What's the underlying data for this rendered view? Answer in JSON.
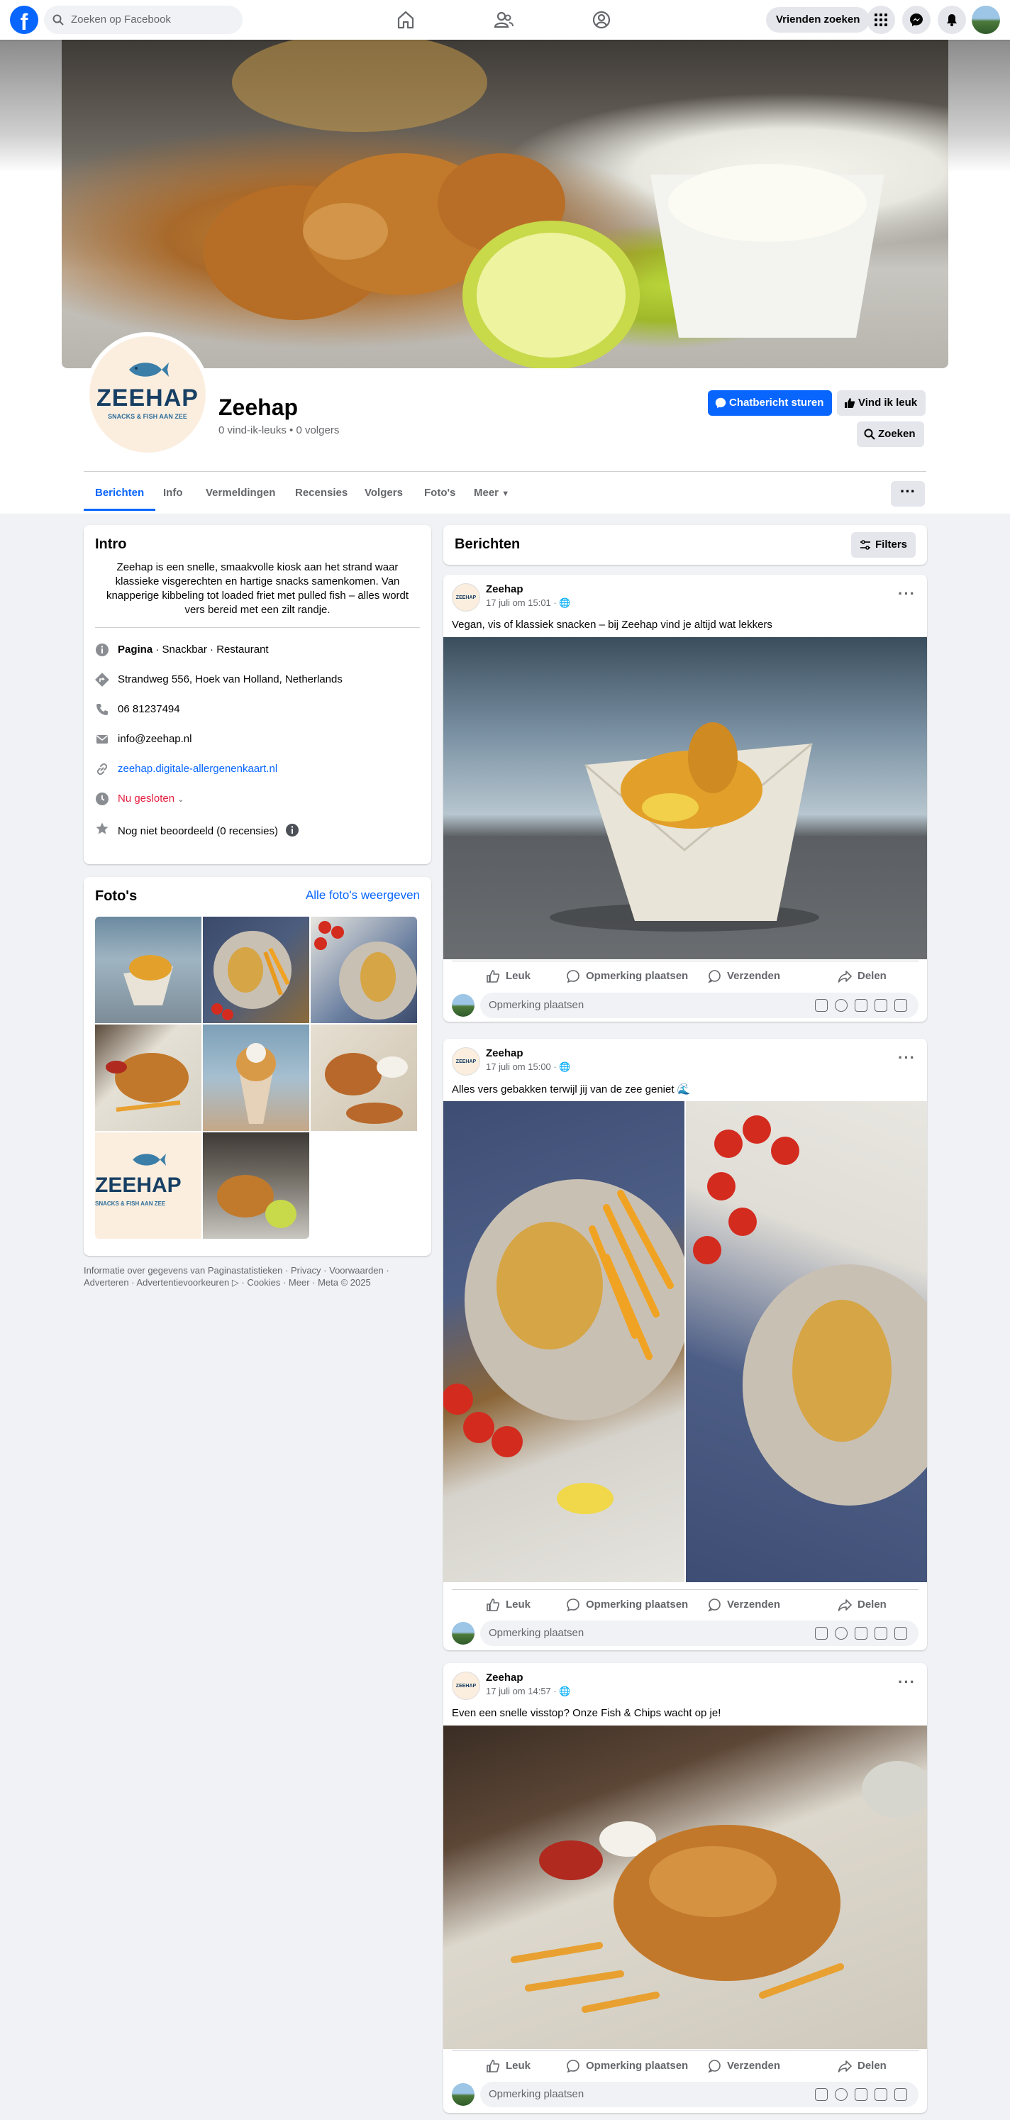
{
  "topnav": {
    "search_placeholder": "Zoeken op Facebook",
    "find_friends_label": "Vrienden zoeken"
  },
  "profile": {
    "name": "Zeehap",
    "meta": "0 vind-ik-leuks • 0 volgers",
    "logo_text": "ZEEHAP",
    "logo_tagline": "SNACKS & FISH AAN ZEE",
    "message_button": "Chatbericht sturen",
    "like_button": "Vind ik leuk",
    "search_button": "Zoeken"
  },
  "tabs": [
    "Berichten",
    "Info",
    "Vermeldingen",
    "Recensies",
    "Volgers",
    "Foto's",
    "Meer"
  ],
  "intro": {
    "title": "Intro",
    "bio": "Zeehap is een snelle, smaakvolle kiosk aan het strand waar klassieke visgerechten en hartige snacks samenkomen. Van knapperige kibbeling tot loaded friet met pulled fish – alles wordt vers bereid met een zilt randje.",
    "category_bold": "Pagina",
    "category_rest": " · Snackbar · Restaurant",
    "address": "Strandweg 556, Hoek van Holland, Netherlands",
    "phone": "06 81237494",
    "email": "info@zeehap.nl",
    "website": "zeehap.digitale-allergenenkaart.nl",
    "hours": "Nu gesloten",
    "rating": "Nog niet beoordeeld (0 recensies)"
  },
  "photos": {
    "title": "Foto's",
    "see_all": "Alle foto's weergeven"
  },
  "footer": {
    "line1": "Informatie over gegevens van Paginastatistieken · Privacy · Voorwaarden ·",
    "line2": "Adverteren · Advertentievoorkeuren ▷ · Cookies · Meer · Meta © 2025"
  },
  "feed": {
    "title": "Berichten",
    "filters": "Filters"
  },
  "posts": [
    {
      "author": "Zeehap",
      "time": "17 juli om 15:01 · 🌐",
      "text": "Vegan, vis of klassiek snacken – bij Zeehap vind je altijd wat lekkers"
    },
    {
      "author": "Zeehap",
      "time": "17 juli om 15:00 · 🌐",
      "text": "Alles vers gebakken terwijl jij van de zee geniet 🌊"
    },
    {
      "author": "Zeehap",
      "time": "17 juli om 14:57 · 🌐",
      "text": "Even een snelle visstop? Onze Fish & Chips wacht op je!"
    }
  ],
  "actions": {
    "like": "Leuk",
    "comment": "Opmerking plaatsen",
    "send": "Verzenden",
    "share": "Delen",
    "comment_placeholder": "Opmerking plaatsen"
  },
  "colors": {
    "accent": "#0866ff",
    "closed": "#e41e3f",
    "logo_navy": "#173f63"
  }
}
